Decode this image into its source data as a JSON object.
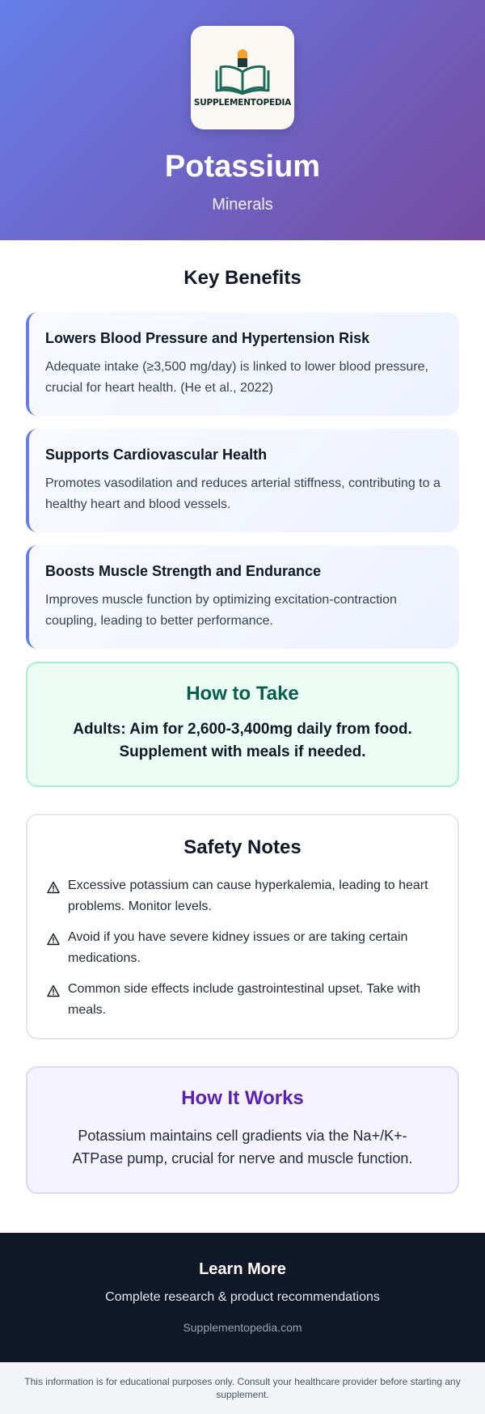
{
  "header": {
    "logo_text": "SUPPLEMENTOPEDIA",
    "title": "Potassium",
    "category": "Minerals"
  },
  "benefits": {
    "heading": "Key Benefits",
    "items": [
      {
        "title": "Lowers Blood Pressure and Hypertension Risk",
        "text": "Adequate intake (≥3,500 mg/day) is linked to lower blood pressure, crucial for heart health. (He et al., 2022)"
      },
      {
        "title": "Supports Cardiovascular Health",
        "text": "Promotes vasodilation and reduces arterial stiffness, contributing to a healthy heart and blood vessels."
      },
      {
        "title": "Boosts Muscle Strength and Endurance",
        "text": "Improves muscle function by optimizing excitation-contraction coupling, leading to better performance."
      }
    ]
  },
  "how_to_take": {
    "heading": "How to Take",
    "text": "Adults: Aim for 2,600-3,400mg daily from food. Supplement with meals if needed."
  },
  "safety": {
    "heading": "Safety Notes",
    "items": [
      {
        "icon": "warning-icon",
        "text": "Excessive potassium can cause hyperkalemia, leading to heart problems. Monitor levels."
      },
      {
        "icon": "warning-icon",
        "text": "Avoid if you have severe kidney issues or are taking certain medications."
      },
      {
        "icon": "warning-icon",
        "text": "Common side effects include gastrointestinal upset. Take with meals."
      }
    ]
  },
  "how_it_works": {
    "heading": "How It Works",
    "text": "Potassium maintains cell gradients via the Na+/K+-ATPase pump, crucial for nerve and muscle function."
  },
  "learn_more": {
    "heading": "Learn More",
    "text": "Complete research & product recommendations",
    "link": "Supplementopedia.com"
  },
  "disclaimer": "This information is for educational purposes only. Consult your healthcare provider before starting any supplement.",
  "colors": {
    "header_gradient_start": "#667eea",
    "header_gradient_end": "#764ba2",
    "benefit_accent": "#667eea",
    "how_to_take_bg": "#ecfdf5",
    "how_to_take_title": "#065f46",
    "how_it_works_bg": "#f5f3ff",
    "how_it_works_title": "#5b21b6",
    "footer_bg": "#111827"
  }
}
